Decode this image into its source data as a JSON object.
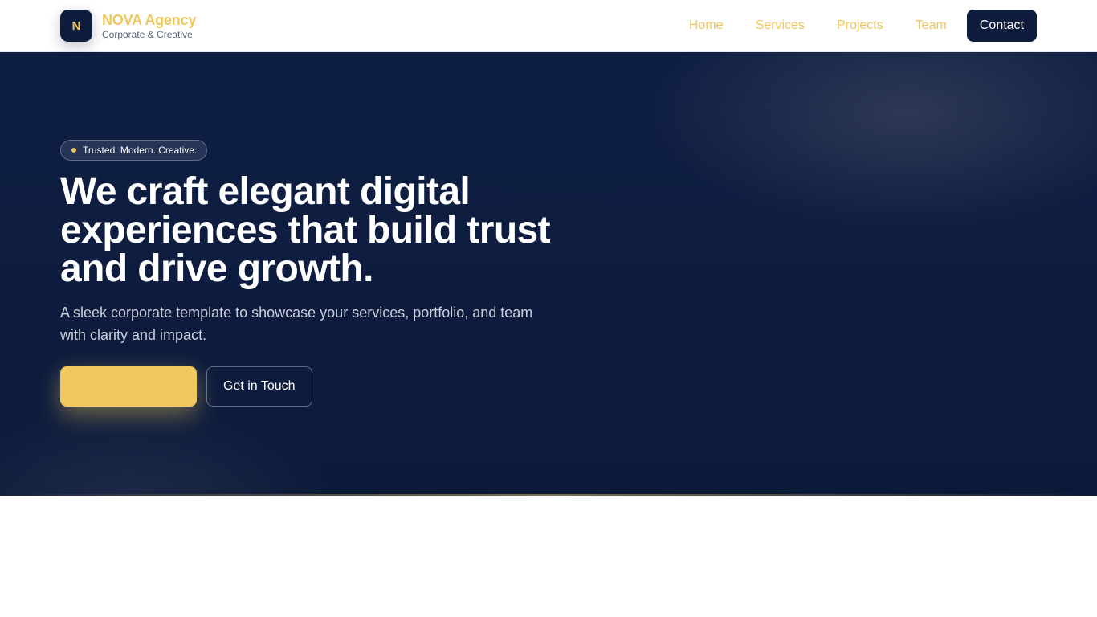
{
  "header": {
    "logo_letter": "N",
    "brand_name": "NOVA Agency",
    "brand_tagline": "Corporate & Creative",
    "nav": {
      "home": "Home",
      "services": "Services",
      "projects": "Projects",
      "team": "Team",
      "contact": "Contact"
    }
  },
  "hero": {
    "badge": "Trusted. Modern. Creative.",
    "title": "We craft elegant digital experiences that build trust and drive growth.",
    "subtitle": "A sleek corporate template to showcase your services, portfolio, and team with clarity and impact.",
    "primary_button_label": "",
    "secondary_button_label": "Get in Touch"
  },
  "colors": {
    "navy": "#0e1c3d",
    "accent_gold": "#f0c75e",
    "hero_background": "#0c1a3a",
    "white": "#ffffff"
  }
}
